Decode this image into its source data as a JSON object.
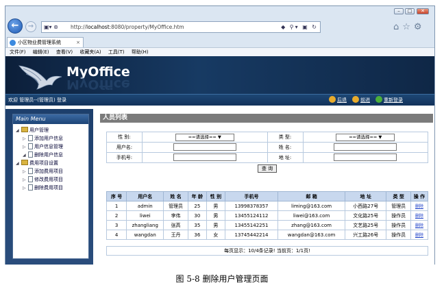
{
  "browser": {
    "url_prefix": "http://",
    "url_host": "localhost",
    "url_rest": ":8080/property/MyOffice.htm",
    "tab_title": "小区物业费管理系统",
    "menu": [
      "文件(F)",
      "编辑(E)",
      "查看(V)",
      "收藏夹(A)",
      "工具(T)",
      "帮助(H)"
    ]
  },
  "app": {
    "logo": "MyOffice",
    "welcome": "欢迎 管理员--(管理员) 登录",
    "nav_back": "后退",
    "nav_forward": "前进",
    "nav_relogin": "重新登录"
  },
  "sidebar": {
    "title": "Main Menu",
    "groups": [
      {
        "label": "用户管理",
        "items": [
          "添加用户信息",
          "用户信息管理",
          "删除用户信息"
        ]
      },
      {
        "label": "费用项目设置",
        "items": [
          "添加费用项目",
          "修改费用项目",
          "删除费用项目"
        ]
      }
    ]
  },
  "main": {
    "title": "人员列表",
    "form": {
      "gender_label": "性  别:",
      "gender_value": "==请选择== ▼",
      "type_label": "类  型:",
      "type_value": "==请选择== ▼",
      "username_label": "用户名:",
      "name_label": "姓  名:",
      "phone_label": "手机号:",
      "address_label": "地  址:",
      "query_button": "查 询"
    },
    "table": {
      "headers": [
        "序 号",
        "用户名",
        "姓 名",
        "年 龄",
        "性 别",
        "手机号",
        "邮 箱",
        "地 址",
        "类 型",
        "操 作"
      ],
      "rows": [
        [
          "1",
          "admin",
          "管理员",
          "25",
          "男",
          "13998378357",
          "liming@163.com",
          "小西路27号",
          "管理员",
          "删除"
        ],
        [
          "2",
          "liwei",
          "李伟",
          "30",
          "男",
          "13455124112",
          "liwei@163.com",
          "文化路25号",
          "操作员",
          "删除"
        ],
        [
          "3",
          "zhangliang",
          "张高",
          "35",
          "男",
          "13455142251",
          "zhang@163.com",
          "文艺路25号",
          "操作员",
          "删除"
        ],
        [
          "4",
          "wangdan",
          "王丹",
          "36",
          "女",
          "13745442214",
          "wangdan@163.com",
          "兴工路26号",
          "操作员",
          "删除"
        ]
      ]
    },
    "pager": "每页显示：10/4条记录! 当前页：1/1页!"
  },
  "caption": "图 5-8  删除用户管理页面"
}
